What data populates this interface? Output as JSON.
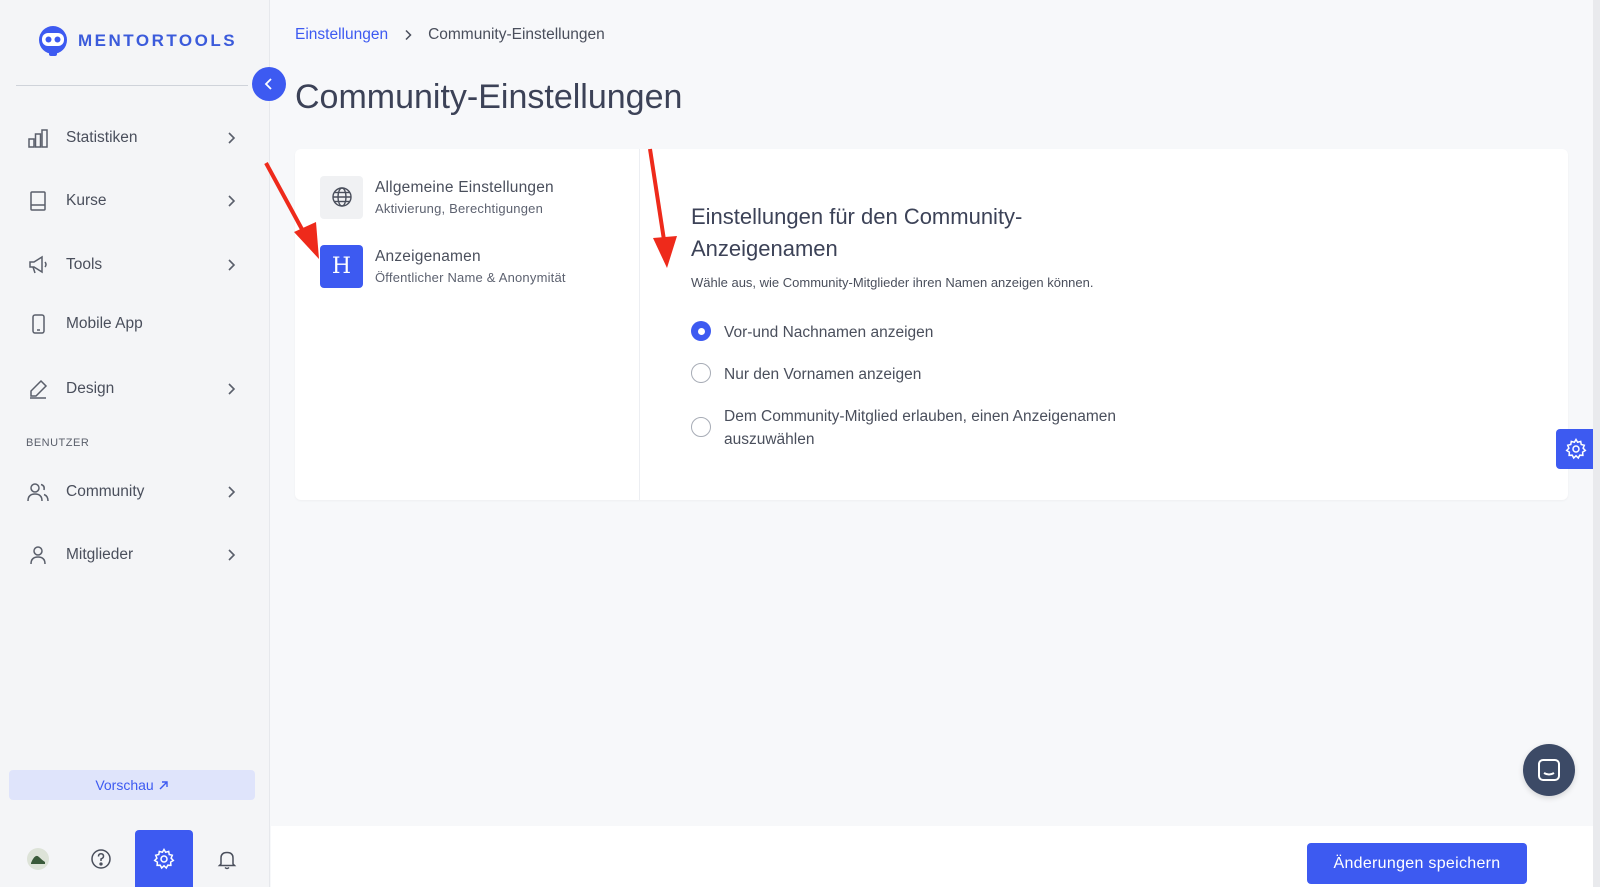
{
  "brand": {
    "name": "MENTORTOOLS",
    "accent": "#3d5af1"
  },
  "sidebar": {
    "items": [
      {
        "label": "Statistiken",
        "icon": "bar-chart-icon",
        "has_children": true
      },
      {
        "label": "Kurse",
        "icon": "book-icon",
        "has_children": true
      },
      {
        "label": "Tools",
        "icon": "megaphone-icon",
        "has_children": true
      },
      {
        "label": "Mobile App",
        "icon": "mobile-icon",
        "has_children": false
      },
      {
        "label": "Design",
        "icon": "pencil-icon",
        "has_children": true
      }
    ],
    "section_label": "BENUTZER",
    "user_items": [
      {
        "label": "Community",
        "icon": "users-icon",
        "has_children": true
      },
      {
        "label": "Mitglieder",
        "icon": "user-icon",
        "has_children": true
      }
    ],
    "preview_label": "Vorschau",
    "bottom_icons": [
      "avatar",
      "help-icon",
      "settings-icon",
      "bell-icon"
    ]
  },
  "breadcrumb": {
    "parent": "Einstellungen",
    "current": "Community-Einstellungen"
  },
  "page_title": "Community-Einstellungen",
  "tabs": [
    {
      "title": "Allgemeine Einstellungen",
      "subtitle": "Aktivierung, Berechtigungen",
      "icon": "globe-icon",
      "active": false
    },
    {
      "title": "Anzeigenamen",
      "subtitle": "Öffentlicher Name & Anonymität",
      "icon_glyph": "H",
      "active": true
    }
  ],
  "settings": {
    "title": "Einstellungen für den Community-Anzeigenamen",
    "description": "Wähle aus, wie Community-Mitglieder ihren Namen anzeigen können.",
    "options": [
      {
        "label": "Vor-und Nachnamen anzeigen",
        "checked": true
      },
      {
        "label": "Nur den Vornamen anzeigen",
        "checked": false
      },
      {
        "label": "Dem Community-Mitglied erlauben, einen Anzeigenamen auszuwählen",
        "checked": false
      }
    ]
  },
  "footer": {
    "save_label": "Änderungen speichern"
  }
}
